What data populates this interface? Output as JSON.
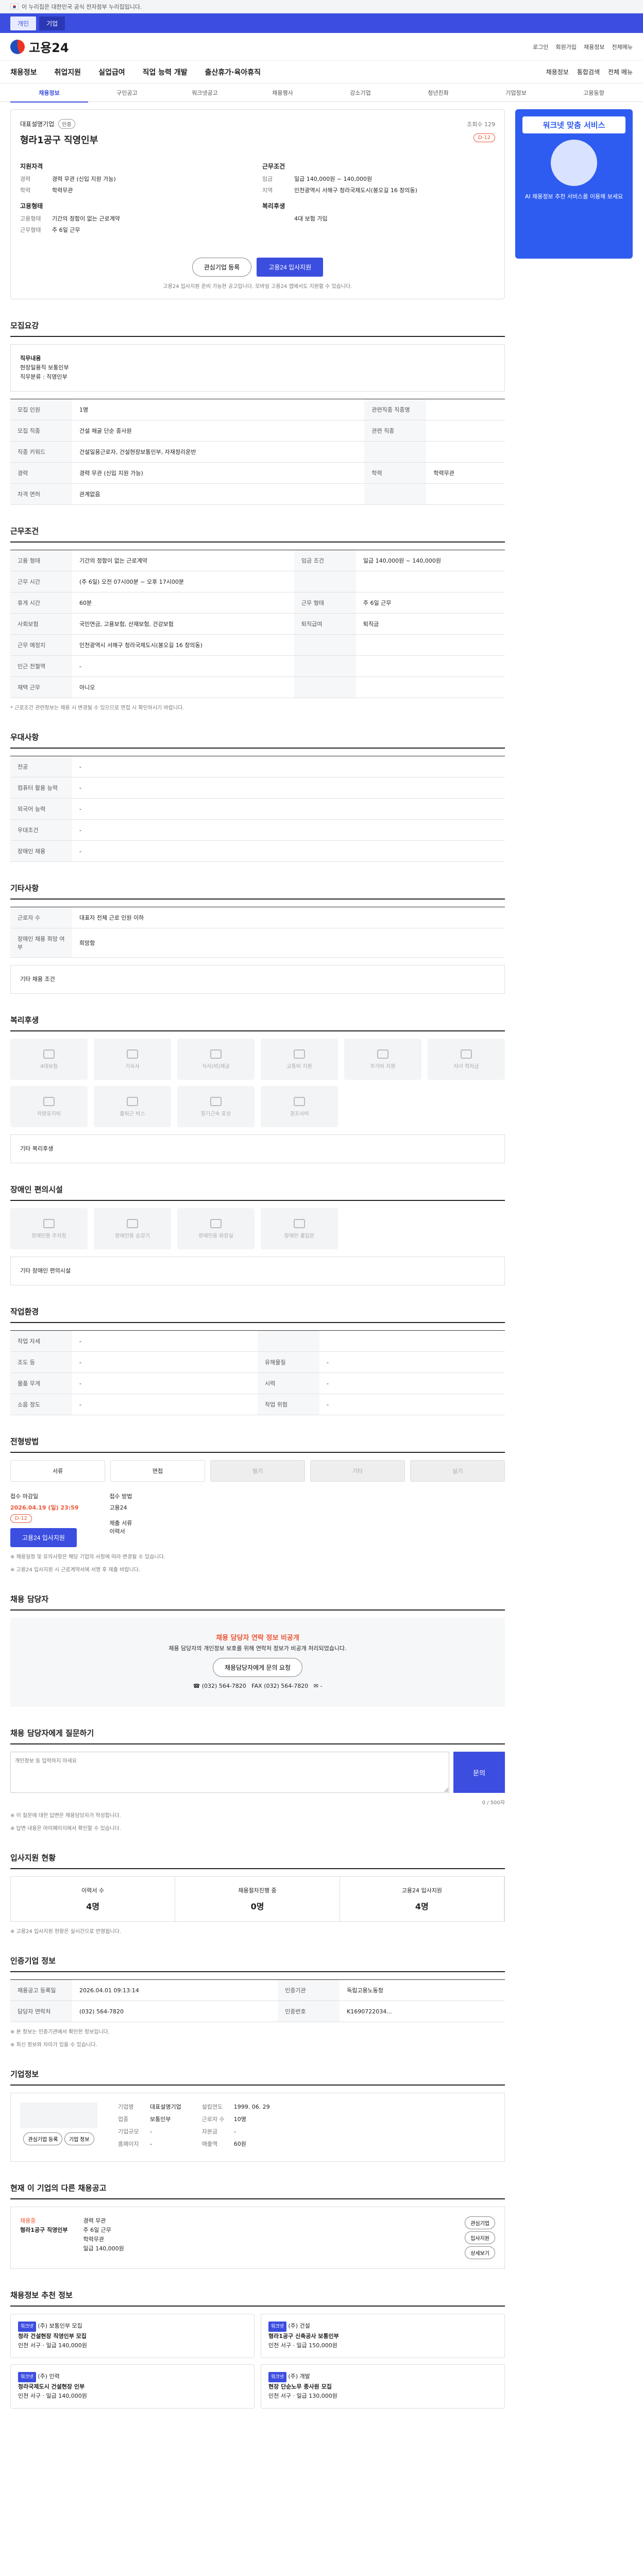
{
  "gov_notice": "이 누리집은 대한민국 공식 전자정부 누리집입니다.",
  "auth": [
    "개인",
    "기업"
  ],
  "logo": "고용24",
  "util": [
    "로그인",
    "회원가입",
    "채용정보",
    "전체메뉴"
  ],
  "gnb": [
    "채용정보",
    "취업지원",
    "실업급여",
    "직업 능력 개발",
    "출산휴가·육아휴직"
  ],
  "gnb_right": [
    "채용정보",
    "통합검색",
    "전체 메뉴"
  ],
  "subnav": [
    "채용정보",
    "구인공고",
    "워크넷공고",
    "채용행사",
    "강소기업",
    "청년친화",
    "기업정보",
    "고용동향"
  ],
  "banner": {
    "title": "워크넷 맞춤 서비스",
    "text": "AI 채용정보 추천 서비스를 이용해 보세요"
  },
  "job": {
    "company": "대표설명기업",
    "badge": "인증",
    "title": "형라1공구 직영인부",
    "views": "조회수 129",
    "dday": "D-12",
    "sum_left_title": "지원자격",
    "sum_left": [
      [
        "경력",
        "경력 무관 (신입 지원 가능)"
      ],
      [
        "학력",
        "학력무관"
      ]
    ],
    "sum_left2_title": "고용형태",
    "sum_left2": [
      [
        "고용형태",
        "기간의 정함이 없는 근로계약"
      ],
      [
        "근무형태",
        "주 6일 근무"
      ]
    ],
    "sum_right_title": "근무조건",
    "sum_right": [
      [
        "임금",
        "일급 140,000원 ~ 140,000원"
      ],
      [
        "지역",
        "인천광역시 서해구 청라국제도시(봉오길 16 창의동)"
      ]
    ],
    "sum_right2_title": "복리후생",
    "sum_right2": [
      [
        "",
        "4대 보험 가입"
      ]
    ],
    "btn_save": "관심기업 등록",
    "btn_apply": "고용24 입사지원",
    "note": "고용24 입사지원 준비 가능한 공고입니다. 모바일 고용24 앱에서도 지원할 수 있습니다."
  },
  "s_recruit": {
    "h": "모집요강",
    "box": [
      "직무내용",
      "현장일용직 보통인부",
      "직무분류 : 직영인부"
    ],
    "rows": [
      [
        "모집 인원",
        "1명",
        "관련직종 직종명",
        ""
      ],
      [
        "모집 직종",
        "건설 채굴 단순 종사원",
        "관련 직종",
        ""
      ],
      [
        "직종 키워드",
        "건설일용근로자, 건설현장보통인부, 자재정리운반",
        "",
        " "
      ],
      [
        "경력",
        "경력 무관 (신입 지원 가능)",
        "학력",
        "학력무관"
      ],
      [
        "자격 면허",
        "관계없음",
        "",
        ""
      ]
    ]
  },
  "s_cond": {
    "h": "근무조건",
    "rows": [
      [
        "고용 형태",
        "기간의 정함이 없는 근로계약",
        "임금 조건",
        "일급 140,000원 ~ 140,000원"
      ],
      [
        "근무 시간",
        "(주 6일) 오전 07시00분 ~ 오후 17시00분",
        "",
        ""
      ],
      [
        "휴게 시간",
        "60분",
        "근무 형태",
        "주 6일 근무"
      ],
      [
        "사회보험",
        "국민연금, 고용보험, 산재보험, 건강보험",
        "퇴직급여",
        "퇴직금"
      ],
      [
        "근무 예정지",
        "인천광역시 서해구 청라국제도시(봉오길 16 창의동)",
        "",
        ""
      ],
      [
        "인근 전철역",
        "-",
        "",
        ""
      ],
      [
        "재택 근무",
        "아니오",
        "",
        ""
      ]
    ],
    "note": "* 근로조건 관련정보는 채용 시 변경될 수 있으므로 면접 시 확인하시기 바랍니다."
  },
  "s_pref": {
    "h": "우대사항",
    "rows": [
      [
        "전공",
        "-"
      ],
      [
        "컴퓨터 활용 능력",
        "-"
      ],
      [
        "외국어 능력",
        "-"
      ],
      [
        "우대조건",
        "-"
      ],
      [
        "장애인 채용",
        "-"
      ]
    ]
  },
  "s_etc": {
    "h": "기타사항",
    "rows": [
      [
        "근로자 수",
        "대표자 전체 근로 인원 이하"
      ],
      [
        "장애인 채용 희망 여부",
        "희망함"
      ]
    ],
    "box": "기타 채용 조건"
  },
  "s_welfare": {
    "h": "복리후생",
    "tiles": [
      "4대보험",
      "기숙사",
      "식사(비)제공",
      "교통비 지원",
      "주거비 지원",
      "자녀 학자금",
      "차량유지비",
      "출퇴근 버스",
      "장기근속 포상",
      "경조사비"
    ],
    "etc": "기타 복리후생"
  },
  "s_disabled": {
    "h": "장애인 편의시설",
    "tiles": [
      "장애인용 주차장",
      "장애인용 승강기",
      "장애인용 화장실",
      "장애인 출입문"
    ],
    "etc": "기타 장애인 편의시설"
  },
  "s_env": {
    "h": "작업환경",
    "rows": [
      [
        "작업 자세",
        "-",
        "",
        ""
      ],
      [
        "조도 등",
        "-",
        "유해물질",
        "-"
      ],
      [
        "물품 무게",
        "-",
        "시력",
        "-"
      ],
      [
        "소음 정도",
        "-",
        "작업 위험",
        "-"
      ]
    ]
  },
  "s_process": {
    "h": "전형방법",
    "steps": [
      "서류",
      "면접",
      "필기",
      "기타",
      "실기"
    ],
    "deadline_label": "접수 마감일",
    "deadline": "2026.04.19 (일) 23:59",
    "dday": "D-12",
    "recv_label": "접수 방법",
    "recv": "고용24",
    "apply": "고용24 입사지원",
    "doc_label": "제출 서류",
    "doc": "이력서",
    "notes": [
      "※ 채용일정 및 유의사항은 해당 기업의 사정에 따라 변경될 수 있습니다.",
      "※ 고용24 입사지원 시 근로계약서에 서명 후 제출 바랍니다."
    ]
  },
  "s_contact": {
    "h": "채용 담당자",
    "head": "채용 담당자 연락 정보 비공개",
    "body": "채용 담당자의 개인정보 보호를 위해 연락처 정보가 비공개 처리되었습니다.",
    "link": "채용담당자에게 문의 요청",
    "phone": "(032) 564-7820",
    "fax": "(032) 564-7820",
    "email": "-"
  },
  "s_qa": {
    "h": "채용 담당자에게 질문하기",
    "placeholder": "개인정보 등 입력하지 마세요",
    "send": "문의",
    "count": "0 / 500자",
    "notes": [
      "※ 이 질문에 대한 답변은 채용담당자가 작성합니다.",
      "※ 답변 내용은 마이페이지에서 확인할 수 있습니다."
    ]
  },
  "s_stats": {
    "h": "입사지원 현황",
    "more": "더보기",
    "items": [
      [
        "이력서 수",
        "4명"
      ],
      [
        "채용절차진행 중",
        "0명"
      ],
      [
        "고용24 입사지원",
        "4명"
      ]
    ],
    "note": "※ 고용24 입사지원 현황은 실시간으로 반영됩니다."
  },
  "s_info": {
    "h": "인증기업 정보",
    "btn": "인증기업 보기",
    "rows": [
      [
        "채용공고 등록일",
        "2026.04.01 09:13:14",
        "인증기관",
        "독립고용노동청"
      ],
      [
        "담당자 연락처",
        "(032) 564-7820",
        "인증번호",
        "K1690722034..."
      ]
    ],
    "notes": [
      "※ 본 정보는 인증기관에서 확인한 정보입니다.",
      "※ 최신 정보와 차이가 있을 수 있습니다."
    ]
  },
  "s_company": {
    "h": "기업정보",
    "more": "더보기",
    "name": "대표설명기업",
    "rows": [
      [
        "기업명",
        "대표설명기업"
      ],
      [
        "업종",
        "보통인부"
      ],
      [
        "기업규모",
        "-"
      ],
      [
        "홈페이지",
        "-"
      ]
    ],
    "right": [
      [
        "설립연도",
        "1999. 06. 29"
      ],
      [
        "근로자 수",
        "10명"
      ],
      [
        "자본금",
        "-"
      ],
      [
        "매출액",
        "60원"
      ]
    ],
    "btn1": "관심기업 등록",
    "btn2": "기업 정보"
  },
  "s_similar": {
    "h": "현재 이 기업의 다른 채용공고",
    "title": "형라1공구 직영인부",
    "status": "채용중",
    "items": [
      "경력 무관",
      "주 6일 근무",
      "학력무관",
      "일급 140,000원"
    ],
    "btns": [
      "관심기업",
      "입사지원",
      "상세보기"
    ]
  },
  "s_rec": {
    "h": "채용정보 추천 정보",
    "cards": [
      [
        "워크넷",
        "(주) 보통인부 모집",
        "청라 건설현장 직영인부 모집",
        "인천 서구",
        "일급 140,000원"
      ],
      [
        "워크넷",
        "(주) 건설",
        "형라1공구 신축공사 보통인부",
        "인천 서구",
        "일급 150,000원"
      ],
      [
        "워크넷",
        "(주) 인력",
        "청라국제도시 건설현장 인부",
        "인천 서구",
        "일급 140,000원"
      ],
      [
        "워크넷",
        "(주) 개발",
        "현장 단순노무 종사원 모집",
        "인천 서구",
        "일급 130,000원"
      ]
    ]
  }
}
